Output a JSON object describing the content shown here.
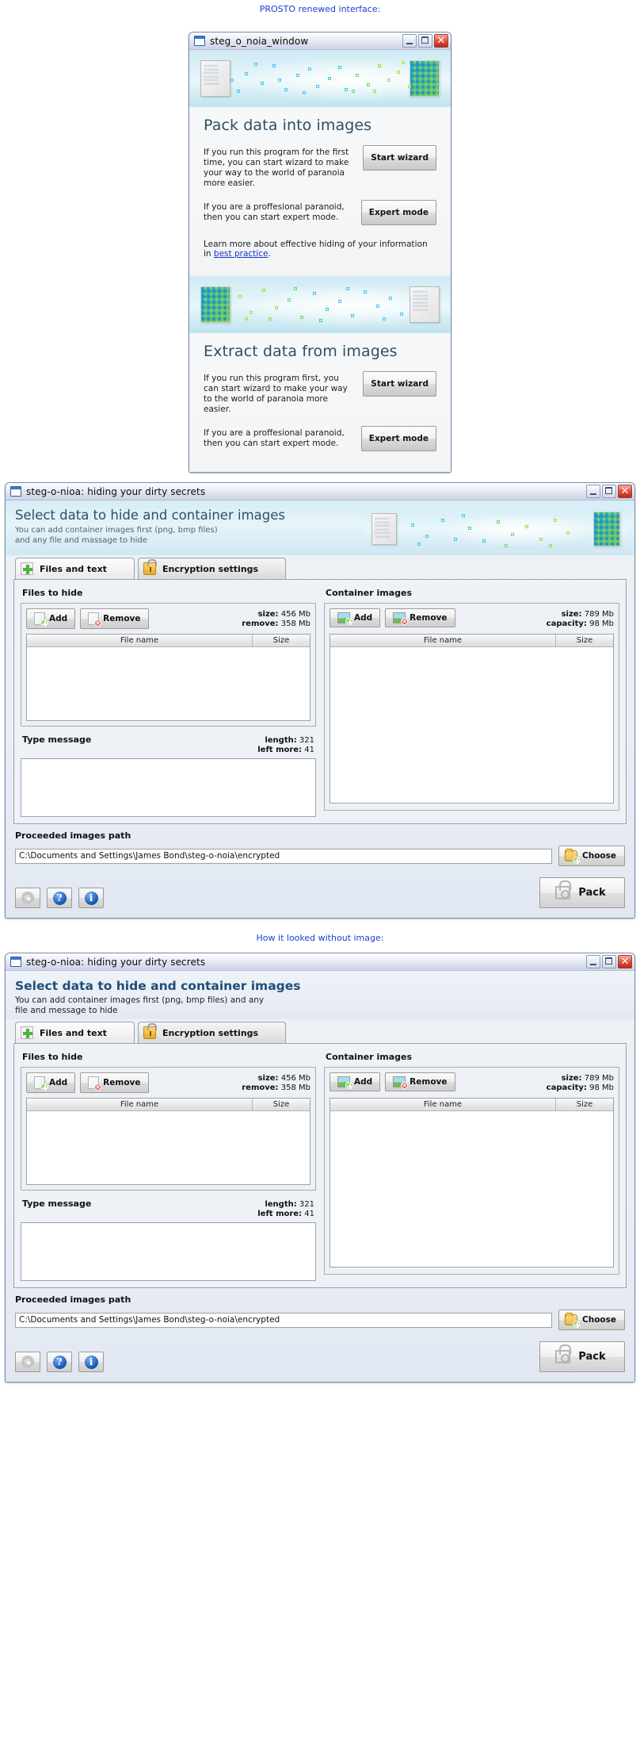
{
  "captions": {
    "top": "PROSTO renewed interface:",
    "middle": "How it looked without image:"
  },
  "window1": {
    "title": "steg_o_noia_window",
    "minimize_label": "Minimize",
    "maximize_label": "Maximize",
    "close_label": "Close",
    "pack": {
      "heading": "Pack data into images",
      "row1_text": "If you run this program for the first time, you can start wizard to make your way to the world of paranoia more easier.",
      "row1_button": "Start wizard",
      "row2_text": "If you are a proffesional paranoid, then you can start expert mode.",
      "row2_button": "Expert mode",
      "learn_prefix": "Learn more about effective hiding of your information in ",
      "learn_link": "best practice",
      "learn_suffix": "."
    },
    "extract": {
      "heading": "Extract data from images",
      "row1_text": "If you run this program first, you can start wizard to make your way to the world of paranoia more easier.",
      "row1_button": "Start wizard",
      "row2_text": "If you are a proffesional paranoid, then you can start expert mode.",
      "row2_button": "Expert mode"
    }
  },
  "app": {
    "title": "steg-o-nioa: hiding your dirty secrets",
    "heading": "Select data to hide and container images",
    "subtitle_with_image": "You can add container images first (png, bmp files)\nand any file and massage to hide",
    "subtitle_without_image": "You can add container images first (png, bmp files)  and any file and message to hide",
    "tabs": [
      {
        "label": "Files and text",
        "icon": "plus-icon",
        "active": true
      },
      {
        "label": "Encryption settings",
        "icon": "lock-icon",
        "active": false
      }
    ],
    "files_to_hide": {
      "title": "Files to hide",
      "add_label": "Add",
      "remove_label": "Remove",
      "stat1_label": "size:",
      "stat1_value": "456 Mb",
      "stat2_label": "remove:",
      "stat2_value": "358 Mb",
      "col_name": "File name",
      "col_size": "Size",
      "rows": []
    },
    "container_images": {
      "title": "Container images",
      "add_label": "Add",
      "remove_label": "Remove",
      "stat1_label": "size:",
      "stat1_value": "789 Mb",
      "stat2_label": "capacity:",
      "stat2_value": "98 Mb",
      "col_name": "File name",
      "col_size": "Size",
      "rows": []
    },
    "message": {
      "title": "Type message",
      "stat1_label": "length:",
      "stat1_value": "321",
      "stat2_label": "left more:",
      "stat2_value": "41",
      "value": ""
    },
    "path": {
      "label": "Proceeded images path",
      "value": "C:\\Documents and Settings\\James Bond\\steg-o-noia\\encrypted",
      "choose_label": "Choose"
    },
    "footer": {
      "settings_label": "Settings",
      "help_label": "Help",
      "info_label": "Info",
      "pack_label": "Pack"
    }
  },
  "colors": {
    "link": "#1433cc",
    "caption": "#1a3fd0",
    "heading": "#2d4f66",
    "close_red": "#c0392b",
    "accent_green": "#4bb53b"
  }
}
